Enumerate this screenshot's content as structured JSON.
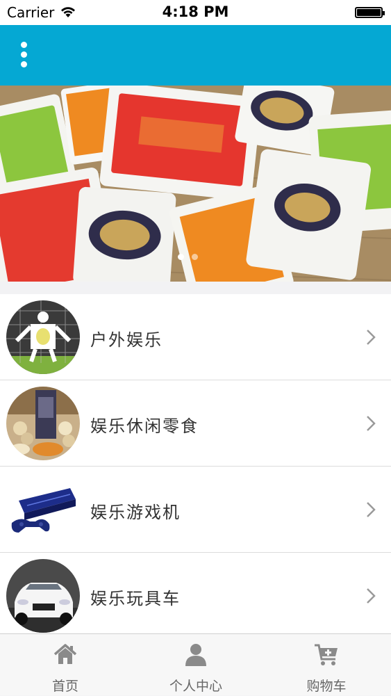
{
  "status_bar": {
    "carrier": "Carrier",
    "time": "4:18 PM"
  },
  "nav": {
    "menu_icon": "more-vertical-icon"
  },
  "banner": {
    "image": "beef-tendon-snack-packs-photo",
    "dots": 2,
    "active_dot": 0
  },
  "list": {
    "items": [
      {
        "label": "户外娱乐",
        "thumb": "soccer-goal-photo"
      },
      {
        "label": "娱乐休闲零食",
        "thumb": "snacks-photo"
      },
      {
        "label": "娱乐游戏机",
        "thumb": "game-console-photo"
      },
      {
        "label": "娱乐玩具车",
        "thumb": "toy-car-photo"
      }
    ]
  },
  "tabs": [
    {
      "label": "首页",
      "icon": "home-icon"
    },
    {
      "label": "个人中心",
      "icon": "user-icon"
    },
    {
      "label": "购物车",
      "icon": "cart-icon"
    }
  ]
}
